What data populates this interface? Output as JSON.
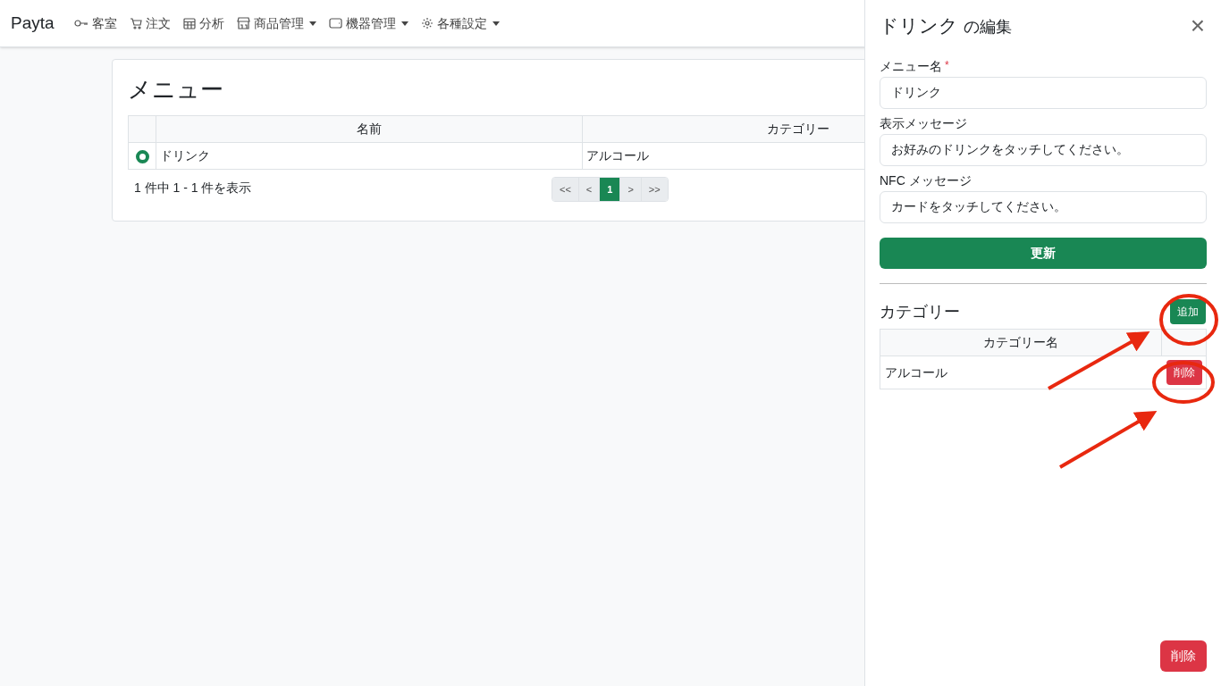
{
  "navbar": {
    "brand": "Payta",
    "items": [
      {
        "label": "客室",
        "dropdown": false
      },
      {
        "label": "注文",
        "dropdown": false
      },
      {
        "label": "分析",
        "dropdown": false
      },
      {
        "label": "商品管理",
        "dropdown": true
      },
      {
        "label": "機器管理",
        "dropdown": true
      },
      {
        "label": "各種設定",
        "dropdown": true
      }
    ]
  },
  "menu_card": {
    "title": "メニュー",
    "table": {
      "columns": [
        "名前",
        "カテゴリー"
      ],
      "rows": [
        {
          "selected": true,
          "cells": [
            "ドリンク",
            "アルコール"
          ]
        }
      ]
    },
    "summary": "1 件中 1 - 1 件を表示",
    "pagination": [
      {
        "label": "<<",
        "selected": false
      },
      {
        "label": "<",
        "selected": false
      },
      {
        "label": "1",
        "selected": true
      },
      {
        "label": ">",
        "selected": false
      },
      {
        "label": ">>",
        "selected": false
      }
    ]
  },
  "edit_panel": {
    "title_name": "ドリンク",
    "title_suffix": "の編集",
    "close": "×",
    "fields": [
      {
        "label": "メニュー名",
        "required_mark": "*",
        "value": "ドリンク"
      },
      {
        "label": "表示メッセージ",
        "value": "お好みのドリンクをタッチしてください。"
      },
      {
        "label": "NFC メッセージ",
        "value": "カードをタッチしてください。"
      }
    ],
    "update_button": "更新",
    "category_section": {
      "title": "カテゴリー",
      "add_button": "追加",
      "columns": [
        "カテゴリー名"
      ],
      "rows": [
        {
          "name": "アルコール",
          "delete_button": "削除"
        }
      ]
    },
    "delete_button": "削除"
  }
}
